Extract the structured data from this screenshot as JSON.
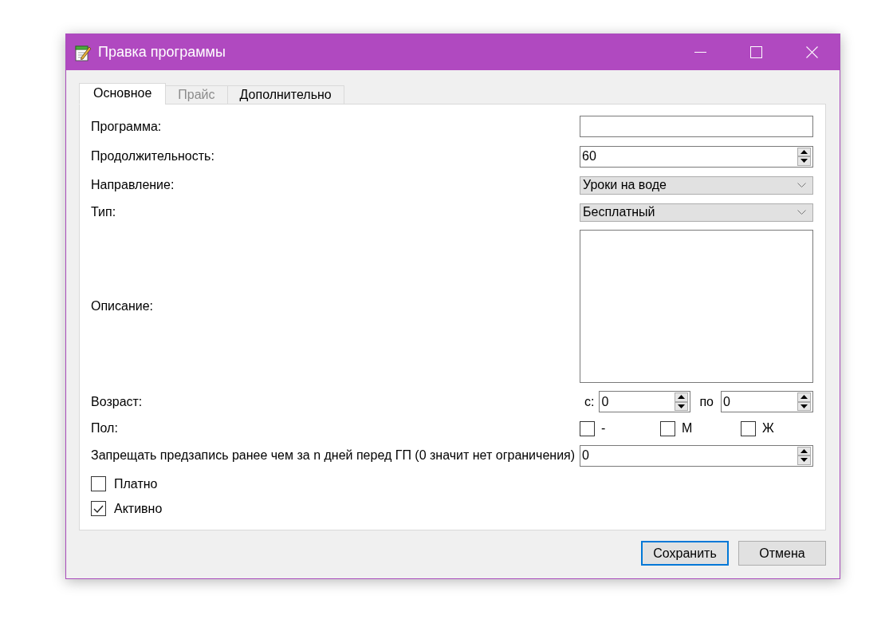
{
  "window": {
    "title": "Правка программы"
  },
  "tabs": [
    {
      "label": "Основное",
      "selected": true,
      "disabled": false
    },
    {
      "label": "Прайс",
      "selected": false,
      "disabled": true
    },
    {
      "label": "Дополнительно",
      "selected": false,
      "disabled": false
    }
  ],
  "form": {
    "rows": [
      {
        "kind": "text",
        "label": "Программа:"
      },
      {
        "kind": "spin",
        "label": "Продолжительность:",
        "value": "60"
      },
      {
        "kind": "combo",
        "label": "Направление:",
        "value": "Уроки на воде"
      },
      {
        "kind": "combo",
        "label": "Тип:",
        "value": "Бесплатный"
      },
      {
        "kind": "textarea",
        "label": "Описание:"
      },
      {
        "kind": "range",
        "label": "Возраст:",
        "from_label": "с:",
        "from_value": "0",
        "to_label": "по",
        "to_value": "0"
      },
      {
        "kind": "checks",
        "label": "Пол:",
        "options": [
          {
            "label": "-",
            "checked": false
          },
          {
            "label": "М",
            "checked": false
          },
          {
            "label": "Ж",
            "checked": false
          }
        ]
      },
      {
        "kind": "spin",
        "label": "Запрещать предзапись ранее чем за n дней перед ГП (0 значит нет ограничения)",
        "value": "0"
      }
    ],
    "checkboxes": [
      {
        "label": "Платно",
        "checked": false
      },
      {
        "label": "Активно",
        "checked": true
      }
    ]
  },
  "buttons": [
    {
      "label": "Сохранить",
      "default": true
    },
    {
      "label": "Отмена",
      "default": false
    }
  ]
}
